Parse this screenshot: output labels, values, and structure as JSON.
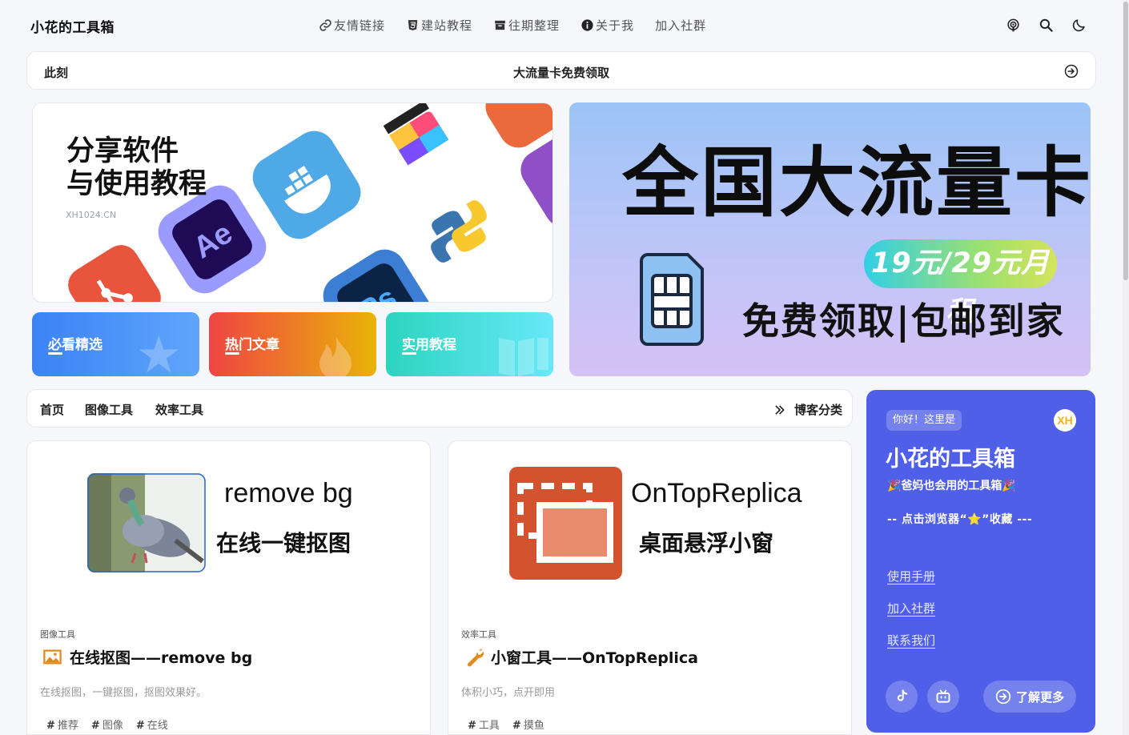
{
  "header": {
    "site_title": "小花的工具箱",
    "nav": [
      {
        "label": "友情链接",
        "icon": "link-icon"
      },
      {
        "label": "建站教程",
        "icon": "html5-icon"
      },
      {
        "label": "往期整理",
        "icon": "archive-icon"
      },
      {
        "label": "关于我",
        "icon": "info-icon"
      },
      {
        "label": "加入社群",
        "icon": ""
      }
    ],
    "icons": [
      "podcast-icon",
      "search-icon",
      "moon-icon"
    ]
  },
  "notice": {
    "label": "此刻",
    "text": "大流量卡免费领取"
  },
  "hero": {
    "title_line1": "分享软件",
    "title_line2": "与使用教程",
    "subtitle": "XH1024.CN",
    "app_icons": [
      "git-icon",
      "after-effects-icon",
      "docker-icon",
      "final-cut-icon",
      "photoshop-icon",
      "python-icon"
    ]
  },
  "categories": [
    {
      "label": "必看精选",
      "color_from": "#3b82f6",
      "color_to": "#60a5fa"
    },
    {
      "label": "热门文章",
      "color_from": "#ef4444",
      "color_to": "#eab308"
    },
    {
      "label": "实用教程",
      "color_from": "#2dd4bf",
      "color_to": "#67e8f9"
    }
  ],
  "banner": {
    "title": "全国大流量卡",
    "price": "19元/29元月租",
    "subtitle": "免费领取|包邮到家"
  },
  "tabs": {
    "items": [
      "首页",
      "图像工具",
      "效率工具"
    ],
    "more": "博客分类"
  },
  "posts": [
    {
      "thumb_title": "remove bg",
      "thumb_sub": "在线一键抠图",
      "category": "图像工具",
      "title": "在线抠图——remove bg",
      "description": "在线抠图，一键抠图，抠图效果好。",
      "tags": [
        "推荐",
        "图像",
        "在线"
      ],
      "icon": "picture-icon"
    },
    {
      "thumb_title": "OnTopReplica",
      "thumb_sub": "桌面悬浮小窗",
      "category": "效率工具",
      "title": "小窗工具——OnTopReplica",
      "description": "体积小巧，点开即用",
      "tags": [
        "工具",
        "摸鱼"
      ],
      "icon": "wrench-icon"
    }
  ],
  "tag_prefix": "#",
  "sidebar": {
    "greeting": "你好！这里是",
    "title": "小花的工具箱",
    "slogan": "🎉爸妈也会用的工具箱🎉",
    "favorite": "-- 点击浏览器“⭐”收藏 ---",
    "links": [
      "使用手册",
      "加入社群",
      "联系我们"
    ],
    "more": "了解更多",
    "logo_text": "XH",
    "bg_color": "#4f5fe8"
  }
}
